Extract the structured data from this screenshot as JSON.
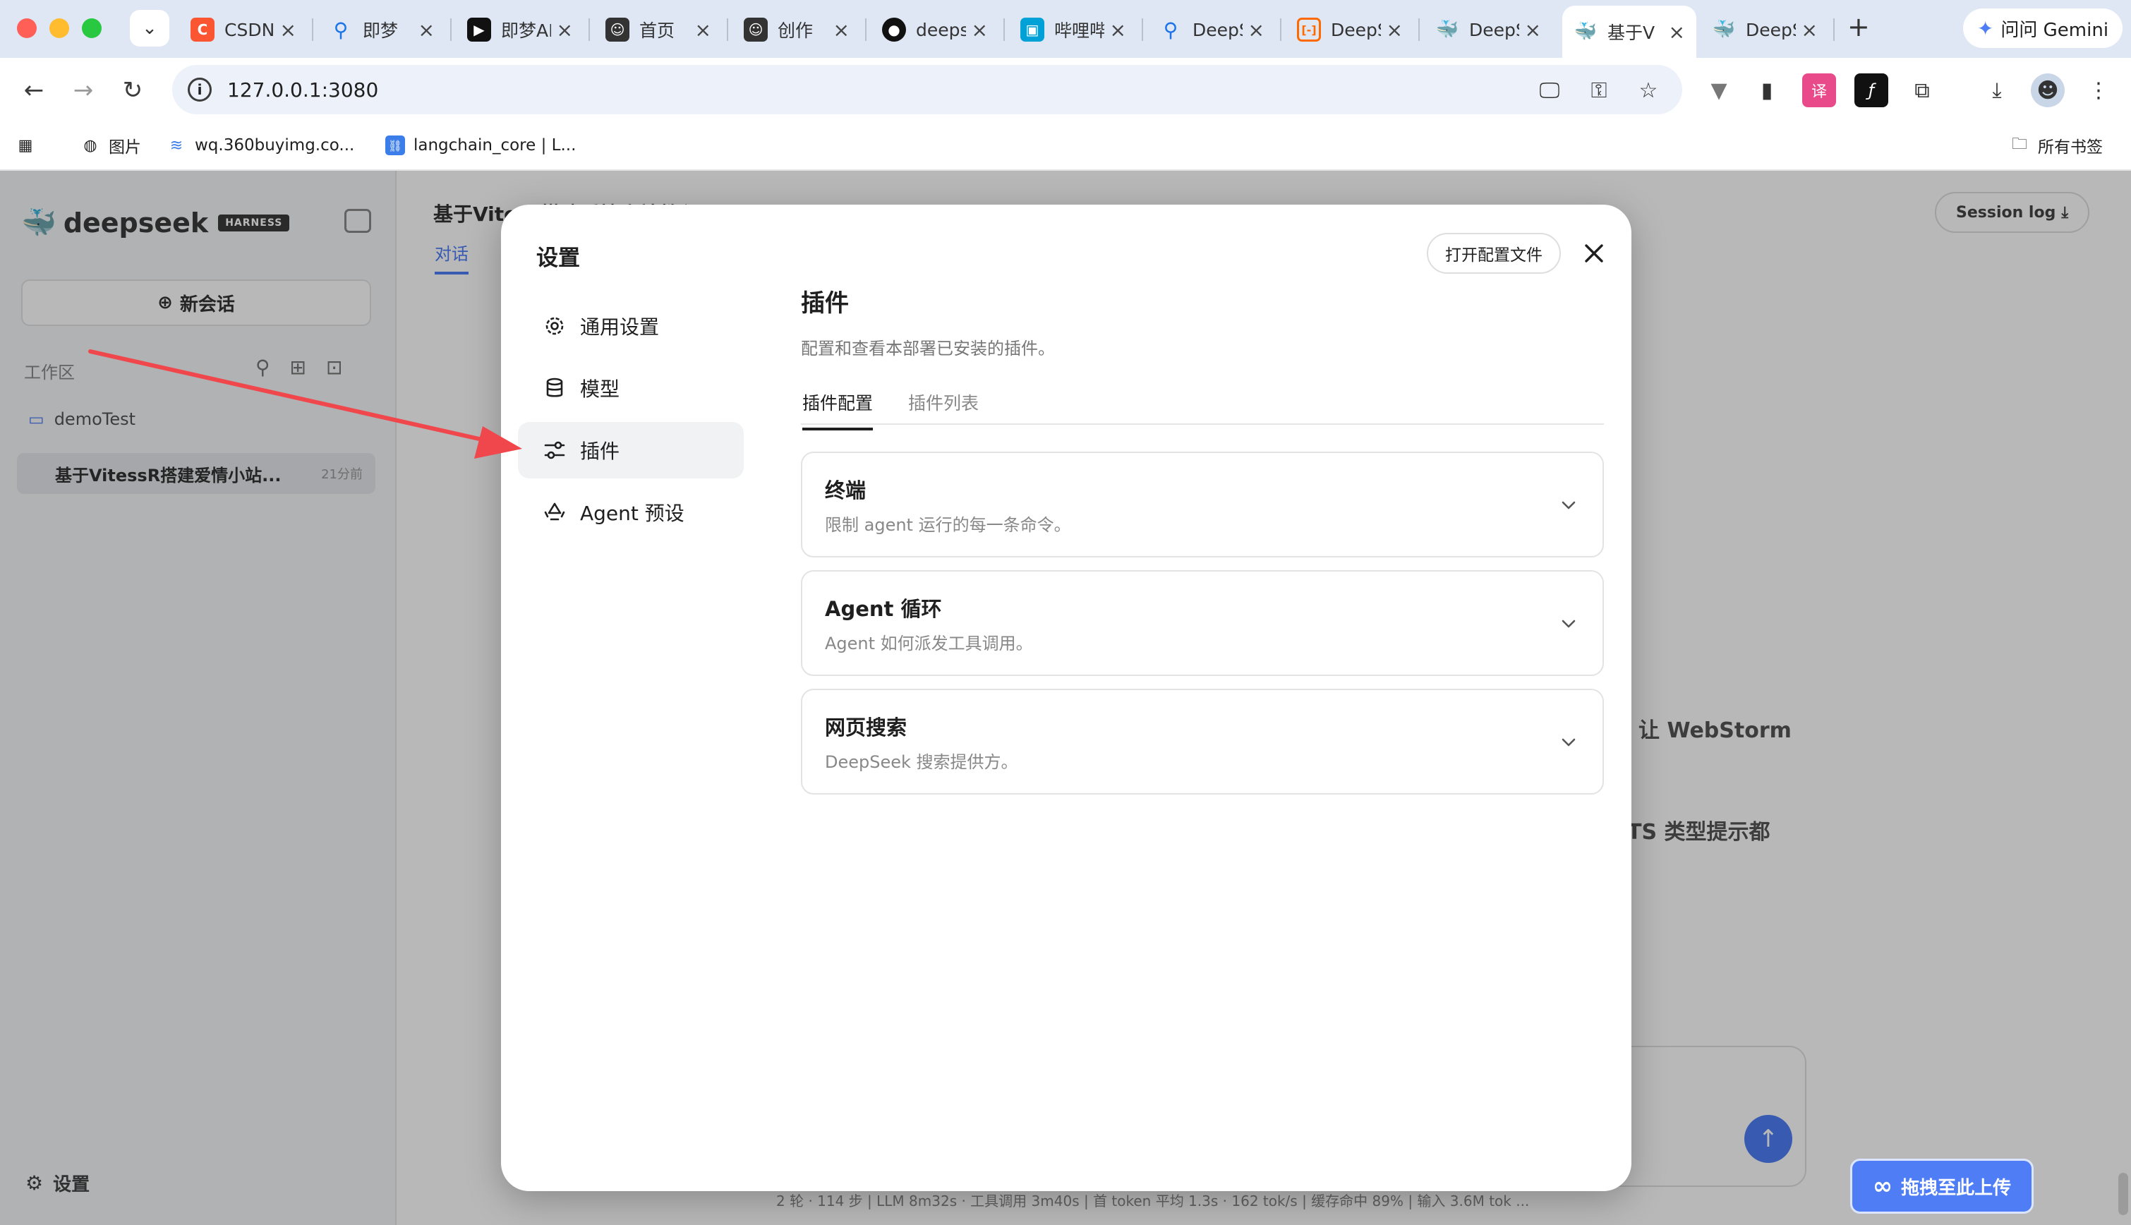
{
  "browser": {
    "tabs": [
      {
        "title": "CSDN",
        "icon": "csdn-icon",
        "color": "#fc5531"
      },
      {
        "title": "即梦",
        "icon": "search-icon",
        "color": "#1a73e8"
      },
      {
        "title": "即梦AI",
        "icon": "jimeng-icon",
        "color": "#111111"
      },
      {
        "title": "首页",
        "icon": "robot-icon",
        "color": "#333333"
      },
      {
        "title": "创作",
        "icon": "robot-icon",
        "color": "#333333"
      },
      {
        "title": "deepseek",
        "icon": "github-icon",
        "color": "#111111"
      },
      {
        "title": "哔哩哔哩",
        "icon": "bilibili-icon",
        "color": "#00a1d6"
      },
      {
        "title": "DeepSeek",
        "icon": "search-icon",
        "color": "#1a73e8"
      },
      {
        "title": "DeepSeek",
        "icon": "aliyun-icon",
        "color": "#ff6a00"
      },
      {
        "title": "DeepSeek",
        "icon": "deepseek-icon",
        "color": "#111111"
      },
      {
        "title": "基于V",
        "icon": "deepseek-icon",
        "color": "#111111"
      },
      {
        "title": "DeepSeek",
        "icon": "deepseek-icon",
        "color": "#111111"
      }
    ],
    "gemini_label": "问问 Gemini",
    "url": "127.0.0.1:3080",
    "bookmarks": [
      {
        "label": "图片"
      },
      {
        "label": "wq.360buyimg.co..."
      },
      {
        "label": "langchain_core | L..."
      }
    ],
    "all_bookmarks_label": "所有书签"
  },
  "app": {
    "logo_text": "deepseek",
    "logo_badge": "HARNESS",
    "new_chat": "新会话",
    "workspace_label": "工作区",
    "folder": "demoTest",
    "session_title": "基于VitessR搭建爱情小站...",
    "session_time": "21分前",
    "settings_label": "设置",
    "header_title": "基于Vitess搭建爱情小站教程",
    "header_tab": "对话",
    "session_log": "Session log",
    "bg_text_1": "让 WebStorm",
    "bg_text_2": "TS 类型提示都",
    "status_line": "2 轮 · 114 步 | LLM 8m32s · 工具调用 3m40s | 首 token 平均 1.3s · 162 tok/s | 缓存命中 89% | 输入 3.6M tok ..."
  },
  "modal": {
    "title": "设置",
    "open_config_label": "打开配置文件",
    "nav": [
      {
        "label": "通用设置",
        "icon": "gear-icon"
      },
      {
        "label": "模型",
        "icon": "database-icon"
      },
      {
        "label": "插件",
        "icon": "sliders-icon",
        "active": true
      },
      {
        "label": "Agent 预设",
        "icon": "recycle-icon"
      }
    ],
    "content": {
      "title": "插件",
      "description": "配置和查看本部署已安装的插件。",
      "tabs": [
        {
          "label": "插件配置",
          "active": true
        },
        {
          "label": "插件列表",
          "active": false
        }
      ],
      "cards": [
        {
          "title": "终端",
          "description": "限制 agent 运行的每一条命令。"
        },
        {
          "title": "Agent 循环",
          "description": "Agent 如何派发工具调用。"
        },
        {
          "title": "网页搜索",
          "description": "DeepSeek 搜索提供方。"
        }
      ]
    }
  },
  "widget": {
    "baidu_label": "拖拽至此上传"
  },
  "colors": {
    "accent": "#4e7df5",
    "annotation_arrow": "#f0474c"
  }
}
